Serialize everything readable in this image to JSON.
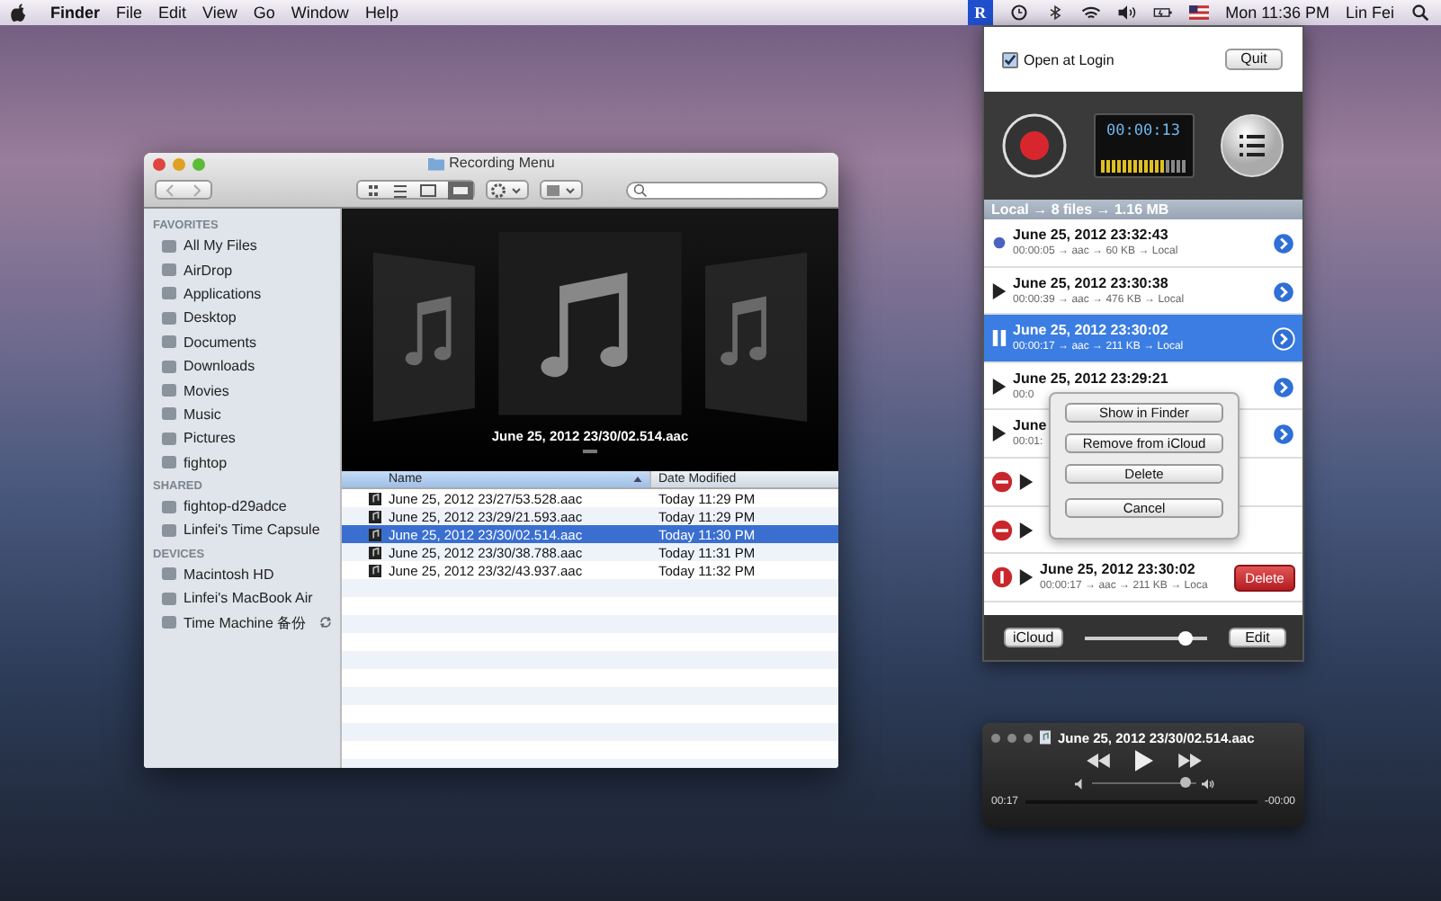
{
  "menu_bar": {
    "app": "Finder",
    "menus": [
      "File",
      "Edit",
      "View",
      "Go",
      "Window",
      "Help"
    ],
    "status_app": {
      "letter": "R",
      "selected": true
    },
    "clock": "Mon 11:36 PM",
    "user": "Lin Fei"
  },
  "finder": {
    "title": "Recording Menu",
    "sidebar": [
      {
        "heading": "FAVORITES",
        "items": [
          {
            "label": "All My Files",
            "selected": false
          },
          {
            "label": "AirDrop",
            "selected": false
          },
          {
            "label": "Applications",
            "selected": false
          },
          {
            "label": "Desktop",
            "selected": false
          },
          {
            "label": "Documents",
            "selected": false
          },
          {
            "label": "Downloads",
            "selected": false
          },
          {
            "label": "Movies",
            "selected": false
          },
          {
            "label": "Music",
            "selected": false
          },
          {
            "label": "Pictures",
            "selected": false
          },
          {
            "label": "fightop",
            "selected": false
          }
        ]
      },
      {
        "heading": "SHARED",
        "items": [
          {
            "label": "fightop-d29adce",
            "selected": false
          },
          {
            "label": "Linfei's Time Capsule",
            "selected": false
          }
        ]
      },
      {
        "heading": "DEVICES",
        "items": [
          {
            "label": "Macintosh HD",
            "selected": false
          },
          {
            "label": "Linfei's MacBook Air",
            "selected": false
          },
          {
            "label": "Time Machine 备份",
            "selected": false,
            "syncing": true
          }
        ]
      }
    ],
    "preview_caption": "June 25, 2012 23/30/02.514.aac",
    "columns": [
      {
        "label": "Name",
        "sorted": true
      },
      {
        "label": "Date Modified",
        "sorted": false
      }
    ],
    "rows": [
      {
        "name": "June 25, 2012 23/27/53.528.aac",
        "date": "Today 11:29 PM",
        "selected": false
      },
      {
        "name": "June 25, 2012 23/29/21.593.aac",
        "date": "Today 11:29 PM",
        "selected": false
      },
      {
        "name": "June 25, 2012 23/30/02.514.aac",
        "date": "Today 11:30 PM",
        "selected": true
      },
      {
        "name": "June 25, 2012 23/30/38.788.aac",
        "date": "Today 11:31 PM",
        "selected": false
      },
      {
        "name": "June 25, 2012 23/32/43.937.aac",
        "date": "Today 11:32 PM",
        "selected": false
      }
    ]
  },
  "recorder": {
    "open_at_login": {
      "label": "Open at Login",
      "checked": true
    },
    "quit": "Quit",
    "timer": "00:00:13",
    "meter": {
      "level": 0.75
    },
    "summary": "Local → 8 files → 1.16 MB",
    "recordings": [
      {
        "kind": "new",
        "title": "June 25, 2012 23:32:43",
        "meta": "00:00:05 → aac → 60 KB → Local",
        "selected": false
      },
      {
        "kind": "stopped",
        "title": "June 25, 2012 23:30:38",
        "meta": "00:00:39 → aac → 476 KB → Local",
        "selected": false
      },
      {
        "kind": "playing",
        "title": "June 25, 2012 23:30:02",
        "meta": "00:00:17 → aac → 211 KB → Local",
        "selected": true
      },
      {
        "kind": "stopped",
        "title": "June 25, 2012 23:29:21",
        "meta": "00:0",
        "selected": false
      },
      {
        "kind": "stopped",
        "title": "June",
        "meta": "00:01:",
        "selected": false
      },
      {
        "kind": "editing",
        "selected": false
      },
      {
        "kind": "editing",
        "selected": false
      },
      {
        "kind": "confirm",
        "title": "June 25, 2012 23:30:02",
        "meta": "00:00:17 → aac → 211 KB → Loca",
        "delete_label": "Delete",
        "selected": false
      }
    ],
    "popup": [
      "Show in Finder",
      "Remove from iCloud",
      "Delete",
      "Cancel"
    ],
    "icloud": "iCloud",
    "slider": {
      "level": 0.82
    },
    "edit": "Edit"
  },
  "player": {
    "title": "June 25, 2012 23/30/02.514.aac",
    "elapsed": "00:17",
    "remaining": "-00:00",
    "volume": {
      "level": 0.9
    }
  }
}
